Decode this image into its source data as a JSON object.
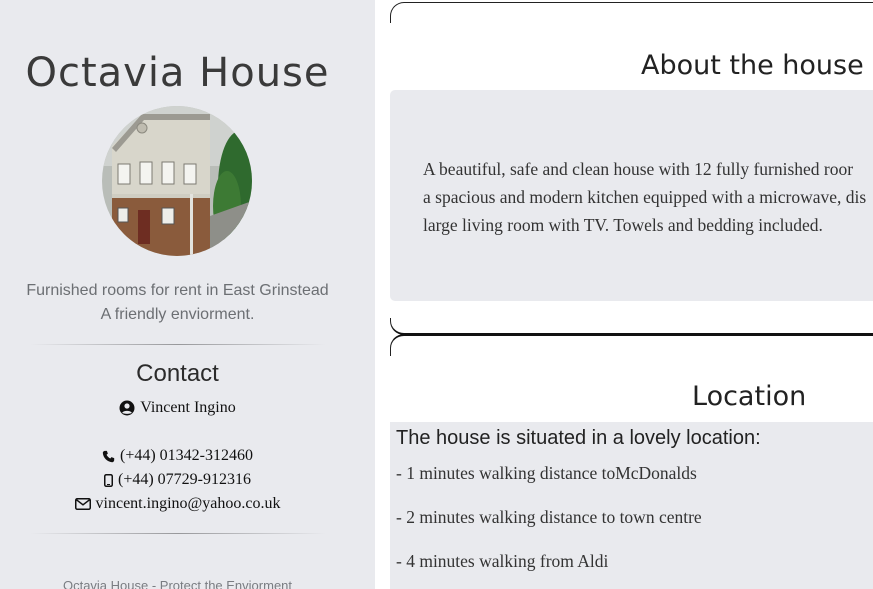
{
  "sidebar": {
    "title": "Octavia House",
    "tagline_line1": "Furnished rooms for rent in East Grinstead",
    "tagline_line2": "A friendly enviorment.",
    "contact": {
      "heading": "Contact",
      "name": "Vincent Ingino",
      "phone": "(+44) 01342-312460",
      "mobile": "(+44) 07729-912316",
      "email": "vincent.ingino@yahoo.co.uk"
    },
    "footer": "Octavia House - Protect the Enviorment"
  },
  "about": {
    "heading": "About the house",
    "lines": [
      "A beautiful, safe and clean house with 12 fully furnished roor",
      "a spacious and modern kitchen equipped with a microwave, dis",
      "large living room with TV. Towels and bedding included."
    ]
  },
  "location": {
    "heading": "Location",
    "intro": "The house is situated in a lovely location:",
    "items": [
      "- 1 minutes walking distance toMcDonalds",
      "- 2 minutes walking distance to town centre",
      "- 4 minutes walking from Aldi"
    ]
  },
  "icons": {
    "user": "user-circle-icon",
    "phone": "phone-icon",
    "mobile": "mobile-icon",
    "email": "envelope-icon"
  },
  "colors": {
    "sidebar_bg": "#e9eaee",
    "box_bg": "#e9eaee",
    "text_muted": "#6c6f73"
  }
}
